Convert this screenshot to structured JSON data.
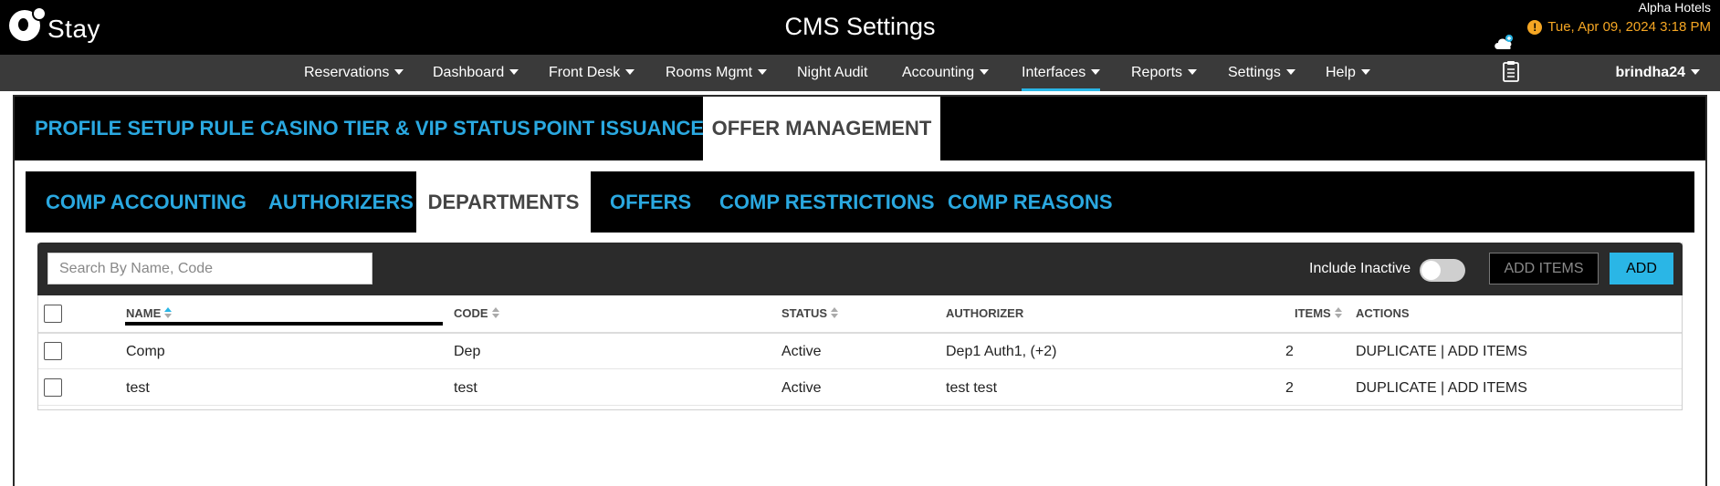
{
  "header": {
    "logo_text": "Stay",
    "title": "CMS Settings",
    "hotel": "Alpha Hotels",
    "datetime": "Tue, Apr 09, 2024 3:18 PM",
    "warn_glyph": "!"
  },
  "nav": {
    "items": [
      "Reservations",
      "Dashboard",
      "Front Desk",
      "Rooms Mgmt",
      "Night Audit",
      "Accounting",
      "Interfaces",
      "Reports",
      "Settings",
      "Help"
    ],
    "active": "Interfaces",
    "user": "brindha24"
  },
  "tabs_primary": [
    "PROFILE SETUP RULE",
    "CASINO TIER & VIP STATUS",
    "POINT ISSUANCE",
    "OFFER MANAGEMENT"
  ],
  "tabs_secondary": [
    "COMP ACCOUNTING",
    "AUTHORIZERS",
    "DEPARTMENTS",
    "OFFERS",
    "COMP RESTRICTIONS",
    "COMP REASONS"
  ],
  "toolbar": {
    "search_placeholder": "Search By Name, Code",
    "search_value": "",
    "include_inactive_label": "Include Inactive",
    "include_inactive_on": false,
    "add_items_label": "ADD ITEMS",
    "add_label": "ADD"
  },
  "table": {
    "columns": {
      "name": "NAME",
      "code": "CODE",
      "status": "STATUS",
      "authorizer": "AUTHORIZER",
      "items": "ITEMS",
      "actions": "ACTIONS"
    },
    "rows": [
      {
        "name": "Comp",
        "code": "Dep",
        "status": "Active",
        "authorizer": "Dep1 Auth1, (+2)",
        "items": "2",
        "actions": "DUPLICATE | ADD ITEMS"
      },
      {
        "name": "test",
        "code": "test",
        "status": "Active",
        "authorizer": "test test",
        "items": "2",
        "actions": "DUPLICATE | ADD ITEMS"
      }
    ]
  },
  "colors": {
    "accent": "#2ab6e6",
    "tab_text": "#2aa8e0",
    "date_warning": "#f5a623",
    "nav_bg": "#3a3a3a"
  }
}
